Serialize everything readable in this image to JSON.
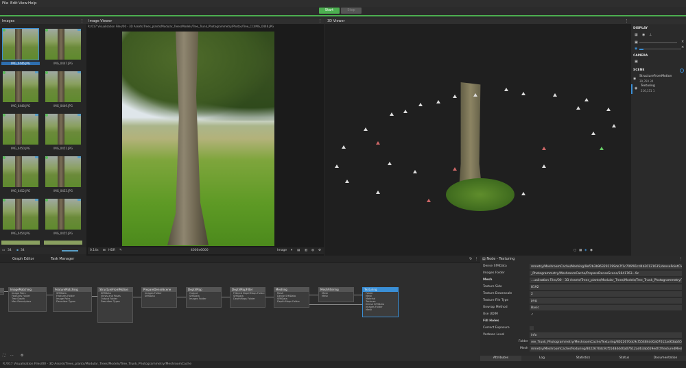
{
  "menu": [
    "File",
    "Edit",
    "View",
    "Help"
  ],
  "run": {
    "start": "Start",
    "stop": "Stop"
  },
  "panels": {
    "images": "Images",
    "image_viewer": "Image Viewer",
    "viewer_3d": "3D Viewer"
  },
  "image_path": "R:/017 Visualisation Files/00 - 3D Assets/Trees_plants/Modular_Trees/Models/Tree_Trunk_Photogrammetry/Photos/Tree_CC/IMG_0446.JPG",
  "thumbnails": [
    "IMG_0446.JPG",
    "IMG_0447.JPG",
    "IMG_0448.JPG",
    "IMG_0449.JPG",
    "IMG_0450.JPG",
    "IMG_0451.JPG",
    "IMG_0452.JPG",
    "IMG_0453.JPG",
    "IMG_0454.JPG",
    "IMG_0455.JPG"
  ],
  "images_footer": {
    "count": "34",
    "second": "34"
  },
  "viewer_footer": {
    "zoom": "0.14x",
    "hdr": "HDR",
    "resolution": "4000x6000",
    "mode": "Image"
  },
  "display": {
    "title": "DISPLAY",
    "camera": "CAMERA",
    "scene": "SCENE"
  },
  "scene_items": [
    {
      "name": "StructureFromMotion",
      "stats": "39,350   34"
    },
    {
      "name": "Texturing",
      "stats": "216,151   1"
    }
  ],
  "bottom_tabs": {
    "graph": "Graph Editor",
    "task": "Task Manager"
  },
  "nodes": [
    {
      "name": "CameraInit",
      "rows": [
        "SfMData"
      ]
    },
    {
      "name": "ImageMatching",
      "rows": [
        "Image Pairs",
        "Features Folder",
        "Tree Depth",
        "Max Descriptors"
      ]
    },
    {
      "name": "FeatureMatching",
      "rows": [
        "SfMData",
        "Features Folder",
        "Image Pairs",
        "Describer Types"
      ]
    },
    {
      "name": "StructureFromMotion",
      "rows": [
        "SfMData",
        "Views and Poses",
        "Output Folder",
        "Describer Types"
      ]
    },
    {
      "name": "PrepareDenseScene",
      "rows": [
        "Images Folder",
        "SfMData"
      ]
    },
    {
      "name": "DepthMap",
      "rows": [
        "Output",
        "SfMData",
        "Images Folder"
      ]
    },
    {
      "name": "DepthMapFilter",
      "rows": [
        "Filtered DepthMaps Folder",
        "SfMData",
        "DepthMaps Folder"
      ]
    },
    {
      "name": "Meshing",
      "rows": [
        "Mesh",
        "Dense SfMData",
        "SfMData",
        "Depth Maps Folder"
      ]
    },
    {
      "name": "MeshFiltering",
      "rows": [
        "Mesh",
        "Mesh"
      ]
    },
    {
      "name": "Texturing",
      "rows": [
        "Folder",
        "Mesh",
        "Material",
        "Textures",
        "Dense SfMData",
        "Images Folder",
        "Mesh"
      ]
    }
  ],
  "attr": {
    "title": "Node - Texturing",
    "rows": [
      {
        "k": "Dense SfMData",
        "v": "mmetry/MeshroomCache/Meshing/9ef2b3b963291199de7f1c706f91cd4b20121635/densePointCloud.abc"
      },
      {
        "k": "Images Folder",
        "v": "_Photogrammetry/MeshroomCache/PrepareDenseScene/3641763...9c"
      },
      {
        "k": "Mesh",
        "v": "...ualisation Files/00 - 3D Assets/Trees_plants/Modular_Trees/Models/Tree_Trunk_Photogrammetry/Tree.obj"
      },
      {
        "k": "Texture Side",
        "v": "8192"
      },
      {
        "k": "Texture Downscale",
        "v": "2"
      },
      {
        "k": "Texture File Type",
        "v": "png"
      },
      {
        "k": "Unwrap Method",
        "v": "Basic"
      },
      {
        "k": "Use UDIM",
        "v": "✓"
      },
      {
        "k": "Fill Holes",
        "v": ""
      },
      {
        "k": "Correct Exposure",
        "v": ""
      },
      {
        "k": "Verbose Level",
        "v": "info"
      },
      {
        "k": "Folder",
        "v": "ree_Trunk_Photogrammetry/MeshroomCache/Texturing/8022670dc9cf55484dd0a07612ad63ab659edfcf"
      },
      {
        "k": "Mesh",
        "v": "mmetry/MeshroomCache/Texturing/8022670dc9cf55484dd0a07612ad63ab659edfcf/texturedMesh.obj"
      }
    ],
    "tabs": [
      "Attributes",
      "Log",
      "Statistics",
      "Status",
      "Documentation"
    ]
  },
  "status_path": "R:/017 Visualisation Files/00 - 3D Assets/Trees_plants/Modular_Trees/Models/Tree_Trunk_Photogrammetry/MeshroomCache",
  "colors": {
    "accent": "#4caf50",
    "selection": "#3a8fd6"
  }
}
